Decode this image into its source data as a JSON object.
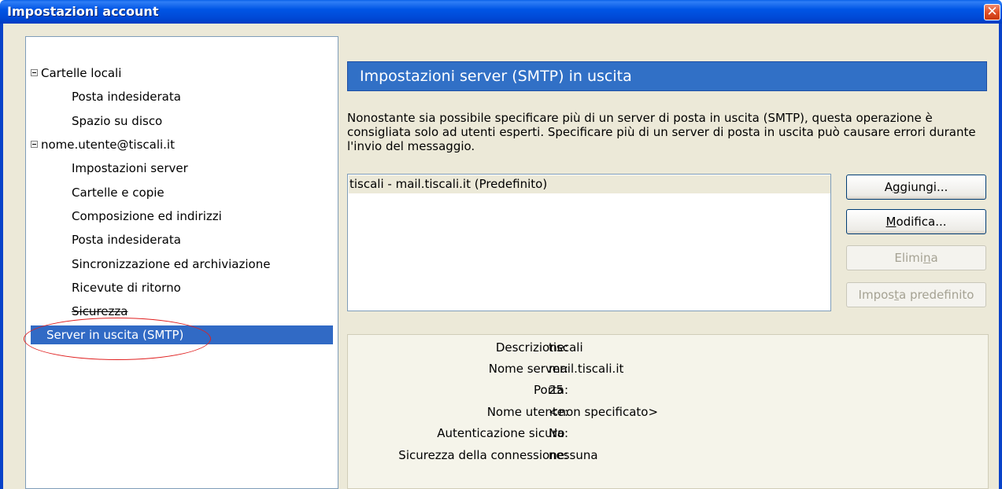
{
  "window": {
    "title": "Impostazioni account",
    "close_glyph": "✕"
  },
  "tree": {
    "groups": [
      {
        "label": "Cartelle locali",
        "expander": "collapse-minus"
      },
      {
        "label": "nome.utente@tiscali.it",
        "expander": "collapse-minus"
      }
    ],
    "local_items": [
      "Posta indesiderata",
      "Spazio su disco"
    ],
    "account_items": [
      "Impostazioni server",
      "Cartelle e copie",
      "Composizione ed indirizzi",
      "Posta indesiderata",
      "Sincronizzazione ed archiviazione",
      "Ricevute di ritorno",
      "Sicurezza"
    ],
    "selected": "Server in uscita (SMTP)"
  },
  "panel": {
    "header": "Impostazioni server (SMTP) in uscita",
    "description": "Nonostante sia possibile specificare più di un server di posta in uscita (SMTP), questa operazione è consigliata solo ad utenti esperti. Specificare più di un server di posta in uscita può causare errori durante l'invio del messaggio.",
    "servers": [
      "tiscali - mail.tiscali.it (Predefinito)"
    ],
    "buttons": {
      "add": {
        "pre": "A",
        "key": "g",
        "post": "giungi..."
      },
      "edit": {
        "pre": "",
        "key": "M",
        "post": "odifica..."
      },
      "delete": {
        "pre": "Elimi",
        "key": "n",
        "post": "a"
      },
      "default": {
        "pre": "Impos",
        "key": "t",
        "post": "a predefinito"
      }
    },
    "details": [
      {
        "label": "Descrizione:",
        "value": "tiscali"
      },
      {
        "label": "Nome server:",
        "value": "mail.tiscali.it"
      },
      {
        "label": "Porta:",
        "value": "25"
      },
      {
        "label": "Nome utente:",
        "value": "<non specificato>"
      },
      {
        "label": "Autenticazione sicura:",
        "value": "No"
      },
      {
        "label": "Sicurezza della connessione:",
        "value": "nessuna"
      }
    ]
  },
  "colors": {
    "selection": "#316ac5",
    "header": "#3170c6",
    "annotation": "#e02020",
    "titlebar": "#0055e5"
  }
}
